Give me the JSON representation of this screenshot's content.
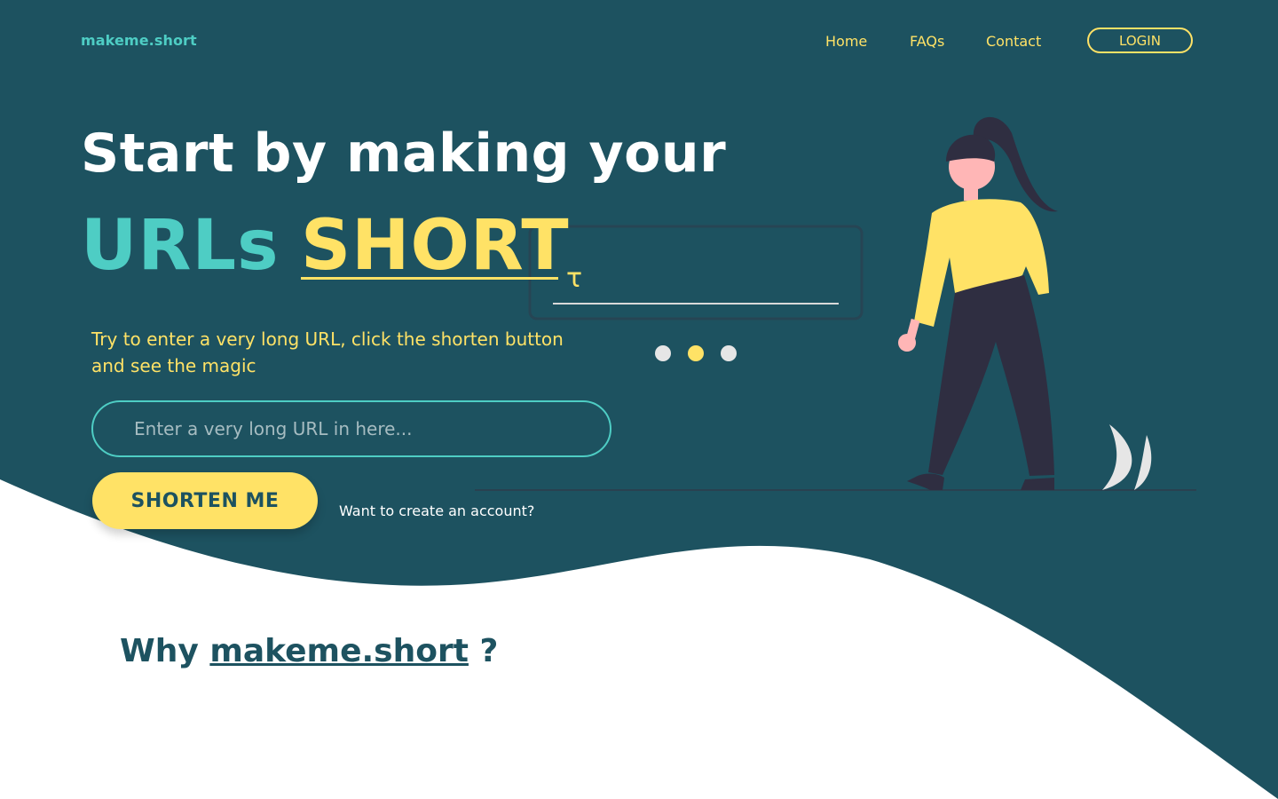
{
  "colors": {
    "background_dark": "#1d5260",
    "accent_teal": "#4ecdc4",
    "accent_yellow": "#ffe266",
    "text_white": "#ffffff",
    "background_light": "#ffffff"
  },
  "nav": {
    "logo": "makeme.short",
    "links": [
      "Home",
      "FAQs",
      "Contact"
    ],
    "login_label": "LOGIN"
  },
  "hero": {
    "headline": "Start by making your",
    "highlight_teal": "URLs",
    "highlight_yellow": "SHORT",
    "subtitle": "Try to enter a very long URL, click the shorten button and see the magic",
    "input_placeholder": "Enter a very long URL in here...",
    "input_value": "",
    "button_label": "SHORTEN ME",
    "account_link": "Want to create an account?",
    "illustration_icon": "woman-walking-illustration"
  },
  "why": {
    "prefix": "Why",
    "brand": "makeme.short",
    "suffix": "?"
  }
}
